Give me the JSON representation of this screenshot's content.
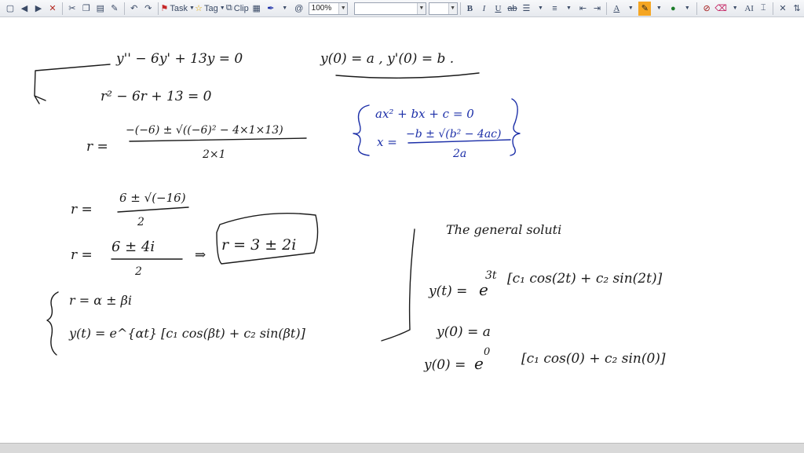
{
  "toolbar": {
    "task_label": "Task",
    "tag_label": "Tag",
    "clip_label": "Clip",
    "zoom_value": "100%",
    "font_name_value": "",
    "font_size_value": "",
    "bold": "B",
    "italic": "I",
    "underline": "U",
    "text_color": "A",
    "ai_label": "AI"
  },
  "notes": {
    "line1": "y'' − 6y' + 13y = 0",
    "line1_ic": "y(0) = a   , y'(0) = b .",
    "char_eq": "r² − 6r + 13 = 0",
    "r_eq_lhs": "r =",
    "quad_num": "−(−6) ± √((−6)² − 4×1×13)",
    "quad_den": "2×1",
    "side_q1": "ax² + bx + c = 0",
    "side_q2_lhs": "x =",
    "side_q2_num": "−b ± √(b² − 4ac)",
    "side_q2_den": "2a",
    "r2_lhs": "r =",
    "r2_num": "6 ± √(−16)",
    "r2_den": "2",
    "r3_lhs": "r =",
    "r3_num": "6 ± 4i",
    "r3_den": "2",
    "r3_arrow": "⇒",
    "r3_result": "r = 3 ± 2i",
    "gen1": "r = α ± βi",
    "gen2": "y(t) = e^{αt} [c₁ cos(βt) + c₂ sin(βt)]",
    "title": "The general soluti",
    "sol_lhs": "y(t) =",
    "sol_exp": "3t",
    "sol_rhs": "[c₁ cos(2t) + c₂ sin(2t)]",
    "ic1": "y(0) = a",
    "ic2_lhs": "y(0) =",
    "ic2_exp": "0",
    "ic2_rhs": "[c₁ cos(0) + c₂ sin(0)]"
  }
}
